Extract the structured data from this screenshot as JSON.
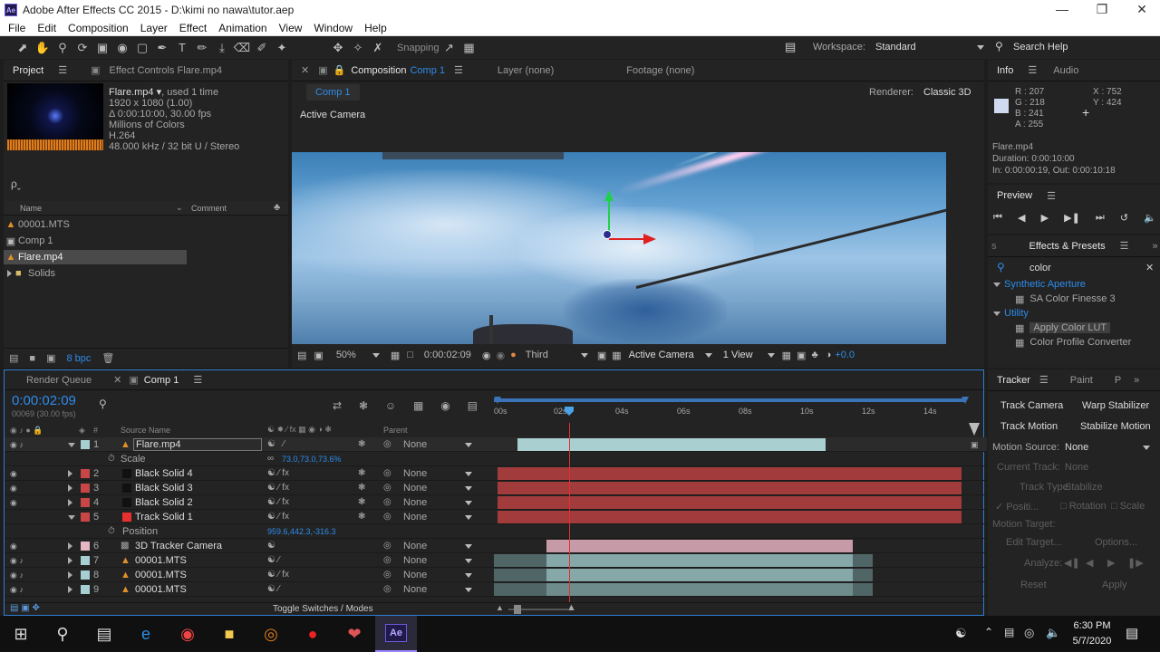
{
  "window": {
    "title": "Adobe After Effects CC 2015 - D:\\kimi no nawa\\tutor.aep",
    "app_badge": "Ae"
  },
  "menu": [
    "File",
    "Edit",
    "Composition",
    "Layer",
    "Effect",
    "Animation",
    "View",
    "Window",
    "Help"
  ],
  "toolbar": {
    "snapping": "Snapping",
    "workspace_label": "Workspace:",
    "workspace_value": "Standard",
    "search_help": "Search Help"
  },
  "project": {
    "tab_project": "Project",
    "tab_effect_controls": "Effect Controls Flare.mp4",
    "footage": {
      "name": "Flare.mp4 ▾",
      "used": ", used 1 time",
      "res": "1920 x 1080 (1.00)",
      "dur": "Δ 0:00:10:00, 30.00 fps",
      "colors": "Millions of Colors",
      "codec": "H.264",
      "audio": "48.000 kHz / 32 bit U / Stereo"
    },
    "search_placeholder": "ρˬ",
    "col_name": "Name",
    "col_comment": "Comment",
    "items": [
      {
        "label": "00001.MTS",
        "icon": "footage-cone-icon"
      },
      {
        "label": "Comp 1",
        "icon": "composition-icon"
      },
      {
        "label": "Flare.mp4",
        "icon": "footage-cone-icon",
        "selected": true
      },
      {
        "label": "Solids",
        "icon": "folder-icon"
      }
    ],
    "bpc": "8 bpc"
  },
  "composition": {
    "tab_label": "Composition",
    "tab_name": "Comp 1",
    "tab_layer": "Layer (none)",
    "tab_footage": "Footage (none)",
    "breadcrumb": "Comp 1",
    "renderer_label": "Renderer:",
    "renderer_value": "Classic 3D",
    "active_camera": "Active Camera",
    "zoom": "50%",
    "timecode": "0:00:02:09",
    "resolution": "Third",
    "camera_view": "Active Camera",
    "views": "1 View",
    "exposure": "+0.0"
  },
  "info": {
    "tab_info": "Info",
    "tab_audio": "Audio",
    "r": "R : 207",
    "g": "G : 218",
    "b": "B : 241",
    "a": "A : 255",
    "x": "X : 752",
    "y": "Y : 424",
    "file": "Flare.mp4",
    "duration": "Duration: 0:00:10:00",
    "inout": "In: 0:00:00:19, Out: 0:00:10:18",
    "swatch": "#cfdaf1"
  },
  "preview": {
    "title": "Preview"
  },
  "effects": {
    "title": "Effects & Presets",
    "search_value": "color",
    "groups": [
      {
        "label": "Synthetic Aperture",
        "items": [
          "SA Color Finesse 3"
        ]
      },
      {
        "label": "Utility",
        "items": [
          "Apply Color LUT",
          "Color Profile Converter"
        ]
      }
    ]
  },
  "timeline": {
    "tab_render": "Render Queue",
    "tab_comp": "Comp 1",
    "timecode": "0:00:02:09",
    "fps": "00069 (30.00 fps)",
    "col_num": "#",
    "col_source": "Source Name",
    "col_parent": "Parent",
    "ruler": [
      "00s",
      "02s",
      "04s",
      "06s",
      "08s",
      "10s",
      "12s",
      "14s"
    ],
    "toggle": "Toggle Switches / Modes",
    "layers": [
      {
        "num": "1",
        "name": "Flare.mp4",
        "color": "#a7cfd1",
        "expanded": true,
        "parent": "None",
        "fx": false,
        "selected": true
      },
      {
        "prop": "Scale",
        "value": "73.0,73.0,73.6%"
      },
      {
        "num": "2",
        "name": "Black Solid 4",
        "color": "#c84646",
        "parent": "None",
        "fx": true
      },
      {
        "num": "3",
        "name": "Black Solid 3",
        "color": "#c84646",
        "parent": "None",
        "fx": true
      },
      {
        "num": "4",
        "name": "Black Solid 2",
        "color": "#c84646",
        "parent": "None",
        "fx": true
      },
      {
        "num": "5",
        "name": "Track Solid 1",
        "color": "#c84646",
        "expanded": true,
        "parent": "None",
        "fx": true
      },
      {
        "prop": "Position",
        "value": "959.6,442.3,-316.3"
      },
      {
        "num": "6",
        "name": "3D Tracker Camera",
        "color": "#e6b8c4",
        "parent": "None",
        "fx": false
      },
      {
        "num": "7",
        "name": "00001.MTS",
        "color": "#a7cfd1",
        "parent": "None",
        "fx": false
      },
      {
        "num": "8",
        "name": "00001.MTS",
        "color": "#a7cfd1",
        "parent": "None",
        "fx": true
      },
      {
        "num": "9",
        "name": "00001.MTS",
        "color": "#a7cfd1",
        "parent": "None",
        "fx": false
      }
    ]
  },
  "tracker": {
    "tab_tracker": "Tracker",
    "tab_paint": "Paint",
    "tab_p": "P",
    "track_camera": "Track Camera",
    "warp_stabilizer": "Warp Stabilizer",
    "track_motion": "Track Motion",
    "stabilize_motion": "Stabilize Motion",
    "motion_source_label": "Motion Source:",
    "motion_source_value": "None",
    "current_track_label": "Current Track:",
    "current_track_value": "None",
    "track_type_label": "Track Type:",
    "track_type_value": "Stabilize",
    "position": "Positi...",
    "rotation": "Rotation",
    "scale": "Scale",
    "motion_target": "Motion Target:",
    "edit_target": "Edit Target...",
    "options": "Options...",
    "analyze": "Analyze:",
    "reset": "Reset",
    "apply": "Apply"
  },
  "taskbar": {
    "time": "6:30 PM",
    "date": "5/7/2020"
  }
}
